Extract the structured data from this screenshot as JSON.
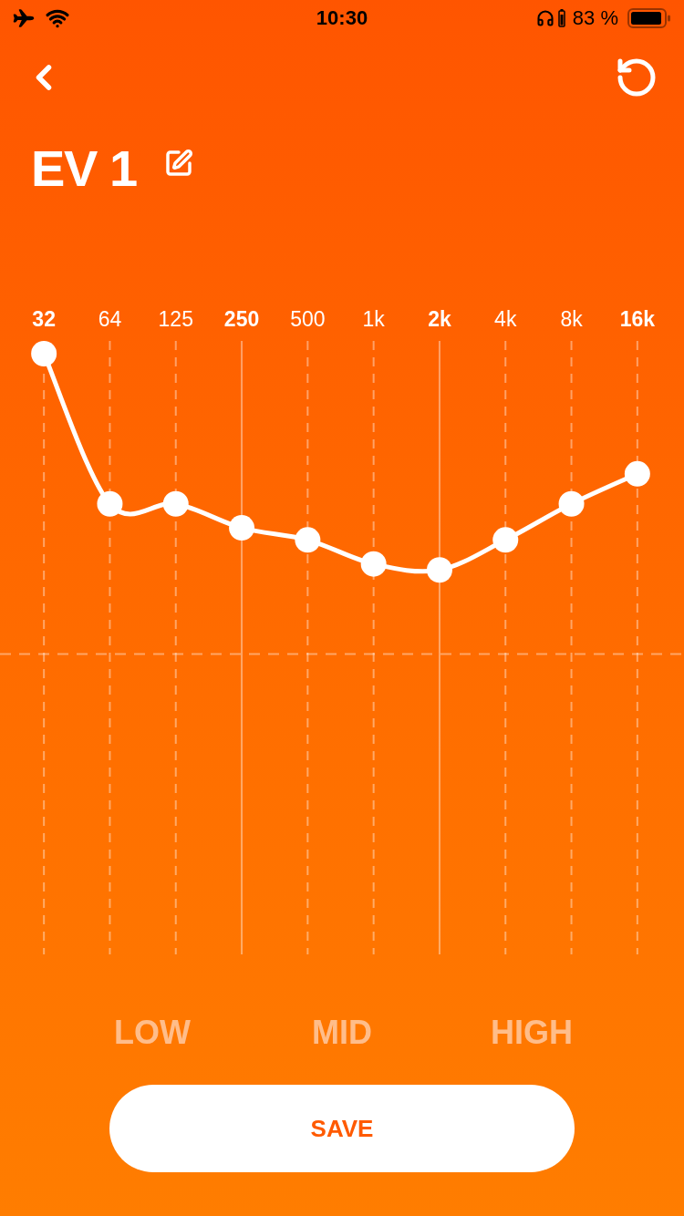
{
  "status_bar": {
    "time": "10:30",
    "battery_percent": "83 %"
  },
  "title": "EV 1",
  "bands": [
    {
      "label": "32",
      "kind": "edge",
      "level": 1.0
    },
    {
      "label": "64",
      "kind": "normal",
      "level": 0.75
    },
    {
      "label": "125",
      "kind": "normal",
      "level": 0.75
    },
    {
      "label": "250",
      "kind": "divider",
      "level": 0.71
    },
    {
      "label": "500",
      "kind": "normal",
      "level": 0.69
    },
    {
      "label": "1k",
      "kind": "normal",
      "level": 0.65
    },
    {
      "label": "2k",
      "kind": "divider",
      "level": 0.64
    },
    {
      "label": "4k",
      "kind": "normal",
      "level": 0.69
    },
    {
      "label": "8k",
      "kind": "normal",
      "level": 0.75
    },
    {
      "label": "16k",
      "kind": "edge",
      "level": 0.8
    }
  ],
  "ranges": [
    "LOW",
    "MID",
    "HIGH"
  ],
  "save_button": "SAVE"
}
